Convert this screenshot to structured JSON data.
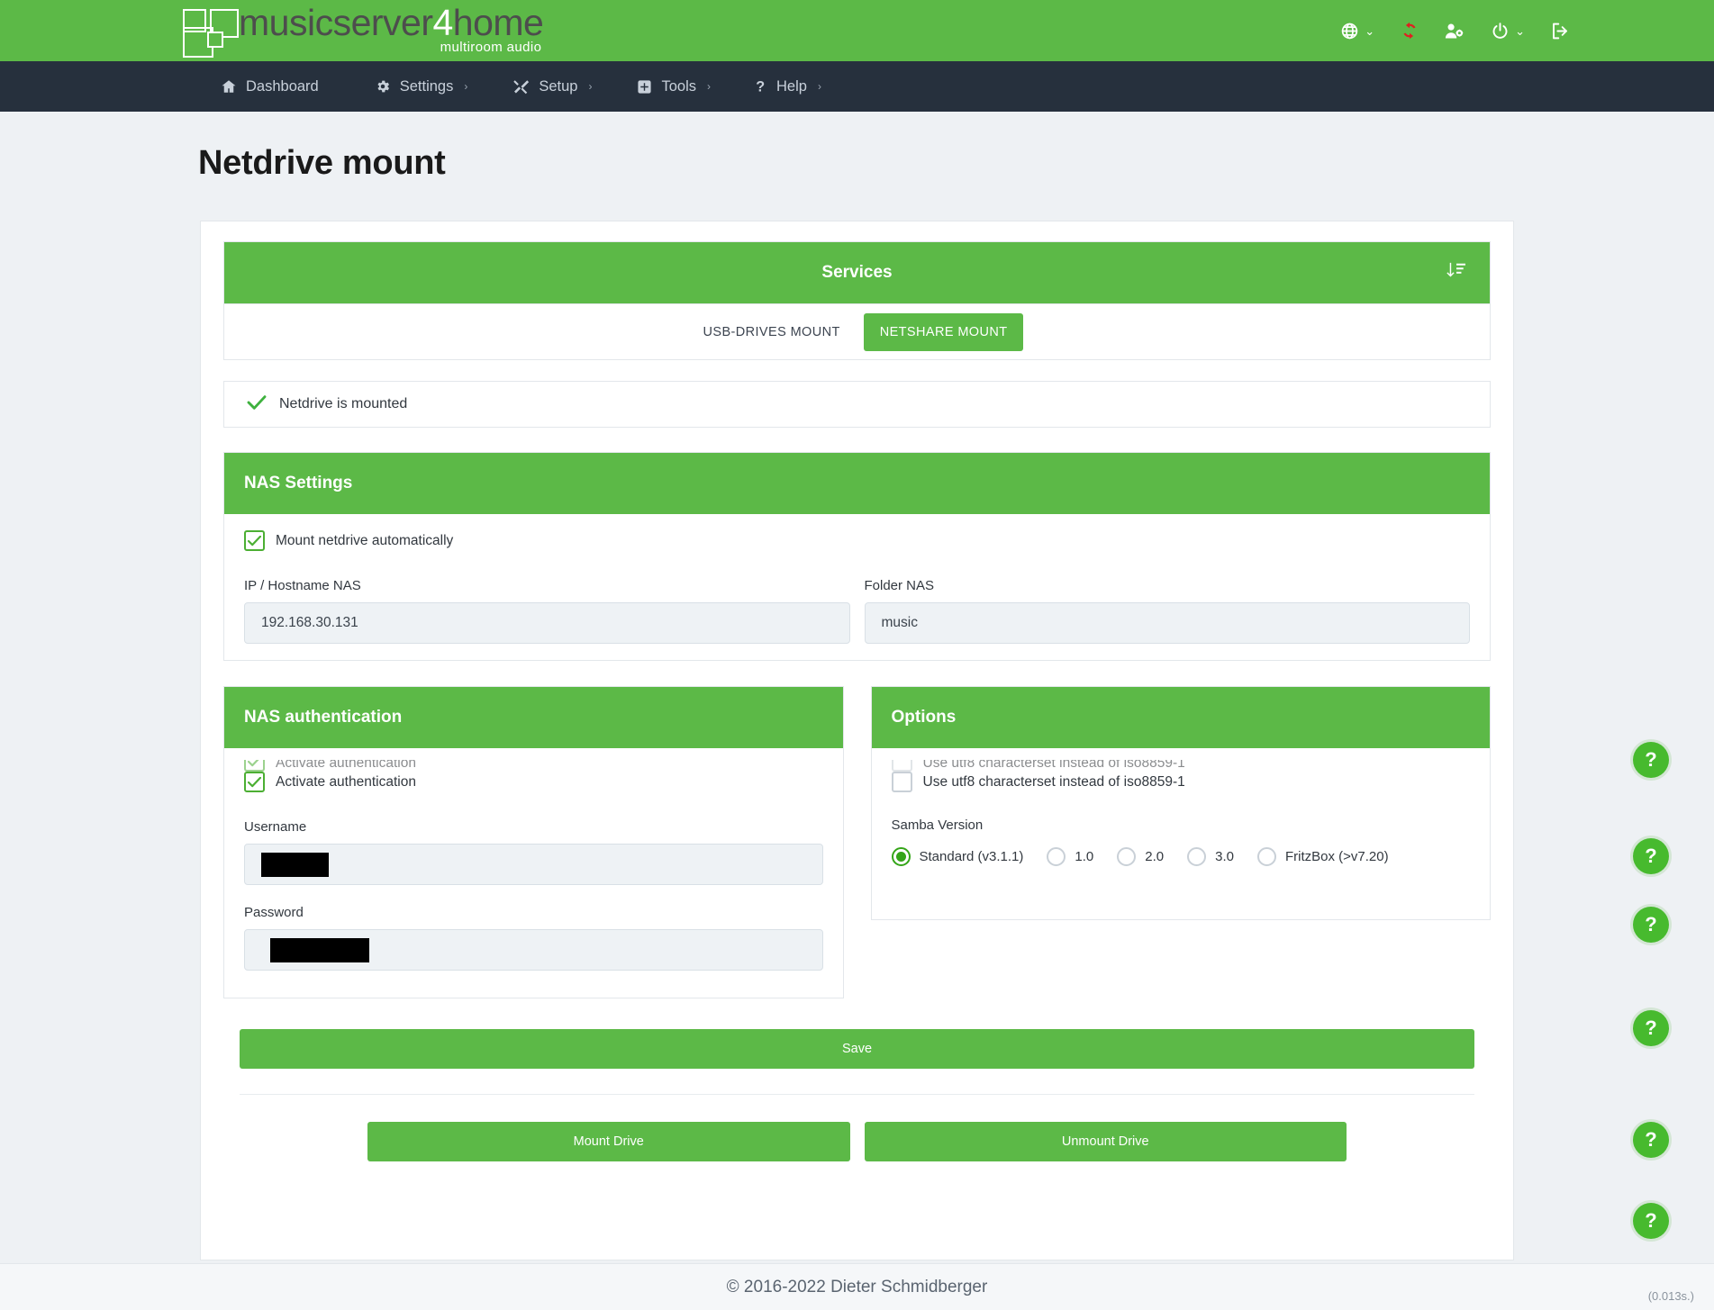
{
  "brand": {
    "name_part1": "musicserver",
    "name_four": "4",
    "name_part2": "home",
    "tagline": "multiroom audio"
  },
  "topbar": {
    "icons": [
      {
        "name": "globe-icon",
        "label": "",
        "caret": "⌄"
      },
      {
        "name": "sync-icon",
        "label": "",
        "caret": ""
      },
      {
        "name": "users-cog-icon",
        "label": "",
        "caret": ""
      },
      {
        "name": "power-icon",
        "label": "",
        "caret": "⌄"
      },
      {
        "name": "logout-icon",
        "label": "",
        "caret": ""
      }
    ]
  },
  "nav": {
    "items": [
      {
        "label": "Dashboard",
        "icon": "home-icon",
        "caret": ""
      },
      {
        "label": "Settings",
        "icon": "gear-icon",
        "caret": "›"
      },
      {
        "label": "Setup",
        "icon": "tools-icon",
        "caret": "›"
      },
      {
        "label": "Tools",
        "icon": "plus-square-icon",
        "caret": "›"
      },
      {
        "label": "Help",
        "icon": "question-icon",
        "caret": "›"
      }
    ]
  },
  "page": {
    "title": "Netdrive mount"
  },
  "services": {
    "header": "Services",
    "sort_icon": "sort-amount-down-icon",
    "tabs": [
      {
        "label": "USB-DRIVES MOUNT",
        "active": false
      },
      {
        "label": "NETSHARE MOUNT",
        "active": true
      }
    ]
  },
  "status": {
    "icon": "check-icon",
    "text": "Netdrive is mounted"
  },
  "nas_settings": {
    "header": "NAS Settings",
    "auto_mount": {
      "label": "Mount netdrive automatically",
      "checked": true
    },
    "fields": [
      {
        "label": "IP / Hostname NAS",
        "value": "192.168.30.131",
        "placeholder": ""
      },
      {
        "label": "Folder NAS",
        "value": "music",
        "placeholder": ""
      }
    ]
  },
  "nas_auth": {
    "header": "NAS authentication",
    "activate": {
      "label": "Activate authentication",
      "checked": true
    },
    "username": {
      "label": "Username",
      "value": "",
      "redacted": true
    },
    "password": {
      "label": "Password",
      "value": "",
      "redacted": true
    }
  },
  "options": {
    "header": "Options",
    "utf8": {
      "label": "Use utf8 characterset instead of iso8859-1",
      "checked": false
    },
    "samba_label": "Samba Version",
    "samba_versions": [
      {
        "label": "Standard (v3.1.1)",
        "selected": true
      },
      {
        "label": "1.0",
        "selected": false
      },
      {
        "label": "2.0",
        "selected": false
      },
      {
        "label": "3.0",
        "selected": false
      },
      {
        "label": "FritzBox (>v7.20)",
        "selected": false
      }
    ]
  },
  "actions": {
    "save": "Save",
    "mount": "Mount Drive",
    "unmount": "Unmount Drive"
  },
  "help_buttons": [
    {
      "label": "?"
    },
    {
      "label": "?"
    },
    {
      "label": "?"
    },
    {
      "label": "?"
    },
    {
      "label": "?"
    },
    {
      "label": "?"
    }
  ],
  "footer": {
    "copyright": "© 2016-2022 Dieter Schmidberger",
    "timing": "(0.013s.)"
  },
  "colors": {
    "brand_green": "#5cb947",
    "nav_dark": "#26303d",
    "page_bg": "#eef1f4"
  }
}
